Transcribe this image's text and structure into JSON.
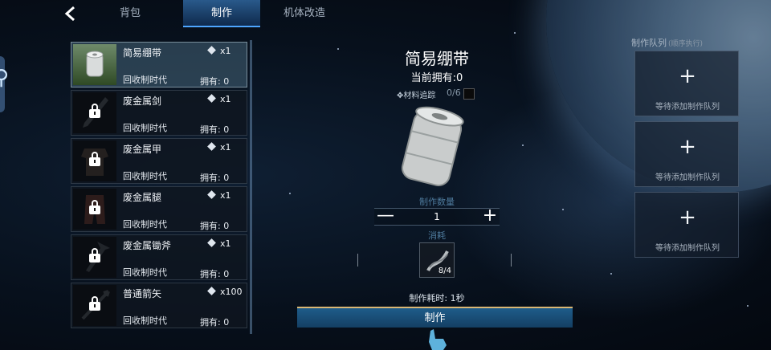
{
  "tabs": [
    {
      "label": "背包",
      "active": false
    },
    {
      "label": "制作",
      "active": true
    },
    {
      "label": "机体改造",
      "active": false
    }
  ],
  "recipes": [
    {
      "name": "简易绷带",
      "qty": "x1",
      "era": "回收制时代",
      "owned": "拥有: 0",
      "locked": false,
      "selected": true
    },
    {
      "name": "废金属剑",
      "qty": "x1",
      "era": "回收制时代",
      "owned": "拥有: 0",
      "locked": true
    },
    {
      "name": "废金属甲",
      "qty": "x1",
      "era": "回收制时代",
      "owned": "拥有: 0",
      "locked": true
    },
    {
      "name": "废金属腿",
      "qty": "x1",
      "era": "回收制时代",
      "owned": "拥有: 0",
      "locked": true
    },
    {
      "name": "废金属锄斧",
      "qty": "x1",
      "era": "回收制时代",
      "owned": "拥有: 0",
      "locked": true
    },
    {
      "name": "普通箭矢",
      "qty": "x100",
      "era": "回收制时代",
      "owned": "拥有: 0",
      "locked": true
    }
  ],
  "detail": {
    "title": "简易绷带",
    "owned_now": "当前拥有:0",
    "track_label": "材料追踪",
    "track_count": "0/6",
    "qty_label": "制作数量",
    "qty_value": "1",
    "consume_label": "消耗",
    "material_count": "8/4",
    "time": "制作耗时: 1秒",
    "craft_button": "制作"
  },
  "queue": {
    "title": "制作队列",
    "subtitle": "(顺序执行)",
    "slots": [
      {
        "label": "等待添加制作队列"
      },
      {
        "label": "等待添加制作队列"
      },
      {
        "label": "等待添加制作队列"
      }
    ]
  },
  "colors": {
    "accent": "#4ea6ff",
    "button": "#1e5c8a",
    "gold": "#d9b775"
  },
  "icons": {
    "back": "chevron-left-icon",
    "lock": "lock-icon",
    "plus": "plus-icon",
    "minus": "minus-icon",
    "cube": "cube-icon",
    "search": "search-icon"
  }
}
